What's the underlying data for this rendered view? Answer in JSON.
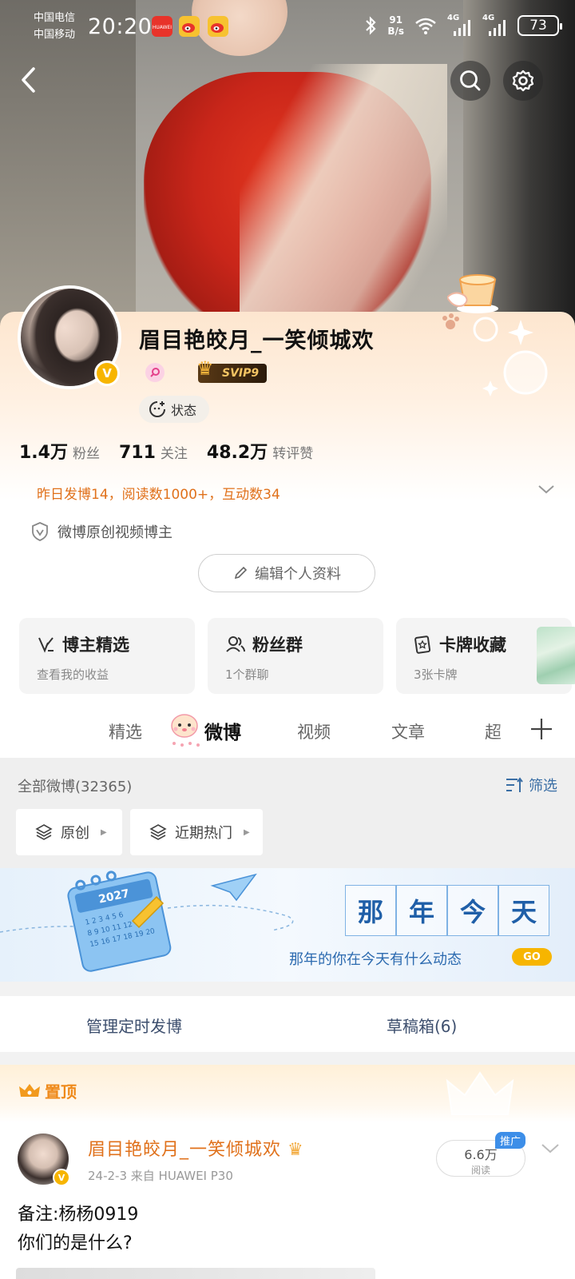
{
  "status_bar": {
    "carrier1": "中国电信",
    "carrier2": "中国移动",
    "time": "20:20",
    "net_speed_value": "91",
    "net_speed_unit": "B/s",
    "net1": "4G",
    "net2": "4G",
    "battery": "73",
    "app_icons": [
      "huawei-app-icon",
      "weibo-icon",
      "weibo-icon"
    ]
  },
  "nav": {
    "back": "back-icon",
    "search": "search-icon",
    "settings": "gear-icon"
  },
  "profile": {
    "name": "眉目艳皎月_一笑倾城欢",
    "verified_mark": "V",
    "svip": "SVIP9",
    "status_label": "状态",
    "stats": [
      {
        "num": "1.4万",
        "label": "粉丝"
      },
      {
        "num": "711",
        "label": "关注"
      },
      {
        "num": "48.2万",
        "label": "转评赞"
      }
    ],
    "yesterday": "昨日发博14，阅读数1000+，互动数34",
    "original_label": "微博原创视频博主",
    "edit_label": "编辑个人资料"
  },
  "feature_cards": [
    {
      "title": "博主精选",
      "sub": "查看我的收益"
    },
    {
      "title": "粉丝群",
      "sub": "1个群聊"
    },
    {
      "title": "卡牌收藏",
      "sub": "3张卡牌"
    }
  ],
  "tabs": [
    "精选",
    "微博",
    "视频",
    "文章",
    "超"
  ],
  "active_tab": "微博",
  "filter": {
    "all_posts": "全部微博(32365)",
    "filter_label": "筛选",
    "chips": [
      "原创",
      "近期热门"
    ]
  },
  "banner": {
    "chars": [
      "那",
      "年",
      "今",
      "天"
    ],
    "sub": "那年的你在今天有什么动态",
    "go": "GO",
    "calendar_year": "2027"
  },
  "manage": {
    "scheduled": "管理定时发博",
    "drafts": "草稿箱(6)"
  },
  "pinned_post": {
    "pin_label": "置顶",
    "author": "眉目艳皎月_一笑倾城欢",
    "meta": "24-2-3  来自 HUAWEI P30",
    "reads_num": "6.6万",
    "reads_label": "阅读",
    "promo": "推广",
    "text_line1": "备注:杨杨0919",
    "text_line2": "你们的是什么?"
  },
  "colors": {
    "accent_orange": "#e0711b",
    "link_blue": "#3a6ea5",
    "vip_gold": "#f7b500"
  }
}
